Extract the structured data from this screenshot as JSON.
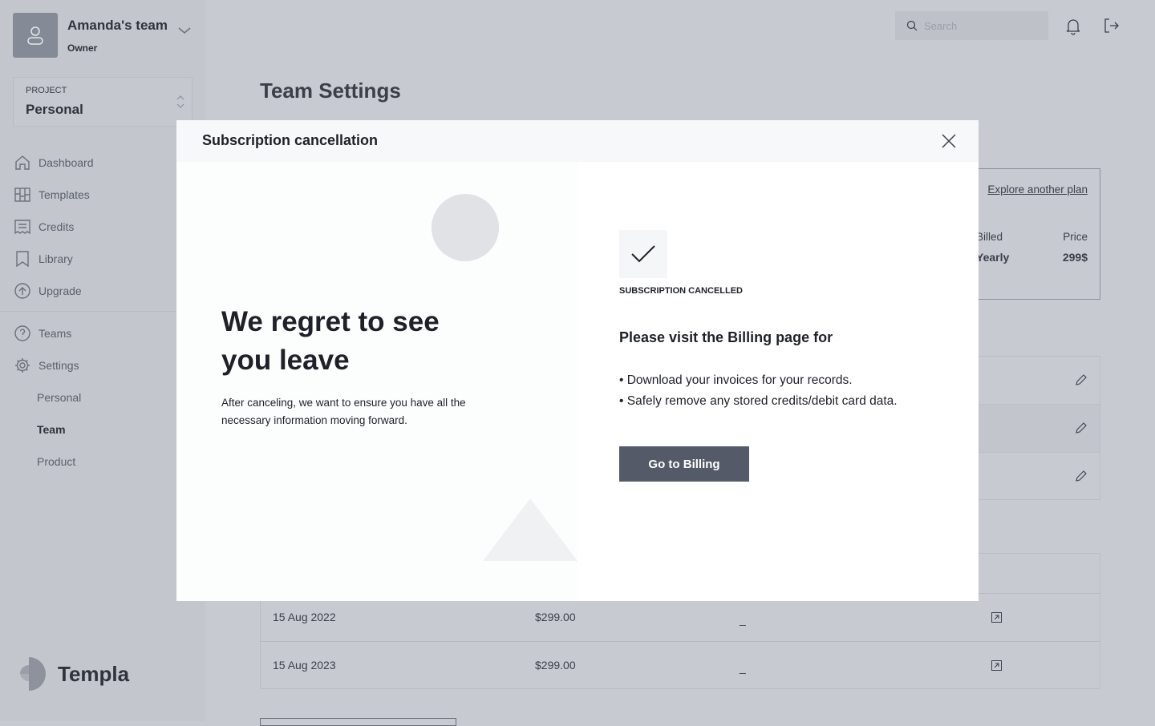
{
  "sidebar": {
    "team_name": "Amanda's team",
    "team_role": "Owner",
    "project_label": "PROJECT",
    "project_value": "Personal",
    "nav": [
      {
        "label": "Dashboard",
        "icon": "home-icon"
      },
      {
        "label": "Templates",
        "icon": "templates-icon"
      },
      {
        "label": "Credits",
        "icon": "receipt-icon"
      },
      {
        "label": "Library",
        "icon": "bookmark-icon"
      },
      {
        "label": "Upgrade",
        "icon": "upgrade-icon"
      },
      {
        "label": "Teams",
        "icon": "help-icon"
      },
      {
        "label": "Settings",
        "icon": "gear-icon"
      }
    ],
    "settings_sub": [
      {
        "label": "Personal"
      },
      {
        "label": "Team",
        "active": true
      },
      {
        "label": "Product"
      }
    ],
    "logo": "Templa"
  },
  "header": {
    "search_placeholder": "Search"
  },
  "page": {
    "title": "Team Settings",
    "plan": {
      "explore": "Explore another plan",
      "billed_label": "Billed",
      "billed_value": "Yearly",
      "price_label": "Price",
      "price_value": "299$"
    },
    "invoices": [
      {
        "date": "15 Aug 2022",
        "amount": "$299.00",
        "status": "_"
      },
      {
        "date": "15 Aug 2023",
        "amount": "$299.00",
        "status": "_"
      }
    ]
  },
  "modal": {
    "title": "Subscription cancellation",
    "heading": "We regret to see you leave",
    "subtext": "After canceling, we want to ensure you have all the necessary information moving forward.",
    "status": "SUBSCRIPTION CANCELLED",
    "visit": "Please visit the Billing page for",
    "bullets": [
      "Download your invoices for your records.",
      "Safely remove any stored credits/debit card data."
    ],
    "button": "Go to Billing"
  }
}
